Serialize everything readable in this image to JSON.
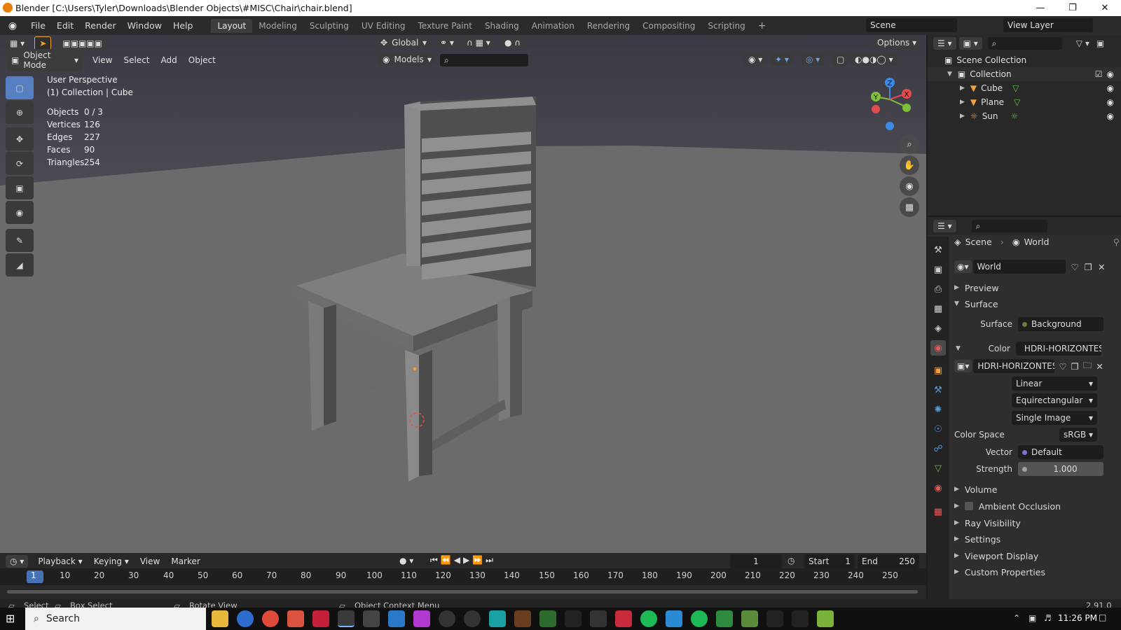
{
  "window": {
    "title": "Blender [C:\\Users\\Tyler\\Downloads\\Blender Objects\\#MISC\\Chair\\chair.blend]"
  },
  "menu": [
    "File",
    "Edit",
    "Render",
    "Window",
    "Help"
  ],
  "workspaces": [
    "Layout",
    "Modeling",
    "Sculpting",
    "UV Editing",
    "Texture Paint",
    "Shading",
    "Animation",
    "Rendering",
    "Compositing",
    "Scripting"
  ],
  "top_right": {
    "scene": "Scene",
    "view_layer": "View Layer"
  },
  "header": {
    "transform": "Global",
    "options": "Options",
    "mode": "Object Mode",
    "menus": [
      "View",
      "Select",
      "Add",
      "Object"
    ],
    "collection_filter": "Models"
  },
  "viewport": {
    "perspective": "User Perspective",
    "context": "(1) Collection | Cube",
    "stats": [
      {
        "label": "Objects",
        "value": "0 / 3"
      },
      {
        "label": "Vertices",
        "value": "126"
      },
      {
        "label": "Edges",
        "value": "227"
      },
      {
        "label": "Faces",
        "value": "90"
      },
      {
        "label": "Triangles",
        "value": "254"
      }
    ],
    "gizmo": {
      "x": "X",
      "y": "Y",
      "z": "Z"
    }
  },
  "outliner": {
    "root": "Scene Collection",
    "collection": "Collection",
    "items": [
      "Cube",
      "Plane",
      "Sun"
    ]
  },
  "properties": {
    "breadcrumb": [
      "Scene",
      "World"
    ],
    "world_name": "World",
    "panels": {
      "preview": "Preview",
      "surface": "Surface"
    },
    "surface_label": "Surface",
    "surface_value": "Background",
    "color_label": "Color",
    "color_value": "HDRI-HORIZONTES-...",
    "image_name": "HDRI-HORIZONTES-...",
    "interpolation": "Linear",
    "projection": "Equirectangular",
    "source": "Single Image",
    "color_space_label": "Color Space",
    "color_space": "sRGB",
    "vector_label": "Vector",
    "vector_value": "Default",
    "strength_label": "Strength",
    "strength": "1.000",
    "collapsed": [
      "Volume",
      "Ambient Occlusion",
      "Ray Visibility",
      "Settings",
      "Viewport Display",
      "Custom Properties"
    ]
  },
  "timeline": {
    "menus": [
      "Playback",
      "Keying",
      "View",
      "Marker"
    ],
    "current_frame": "1",
    "start_label": "Start",
    "start": "1",
    "end_label": "End",
    "end": "250",
    "ticks": [
      "1",
      "10",
      "20",
      "30",
      "40",
      "50",
      "60",
      "70",
      "80",
      "90",
      "100",
      "110",
      "120",
      "130",
      "140",
      "150",
      "160",
      "170",
      "180",
      "190",
      "200",
      "210",
      "220",
      "230",
      "240",
      "250"
    ]
  },
  "statusbar": {
    "select": "Select",
    "box_select": "Box Select",
    "rotate_view": "Rotate View",
    "context_menu": "Object Context Menu",
    "version": "2.91.0"
  },
  "taskbar": {
    "search": "Search",
    "time": "11:26 PM"
  }
}
